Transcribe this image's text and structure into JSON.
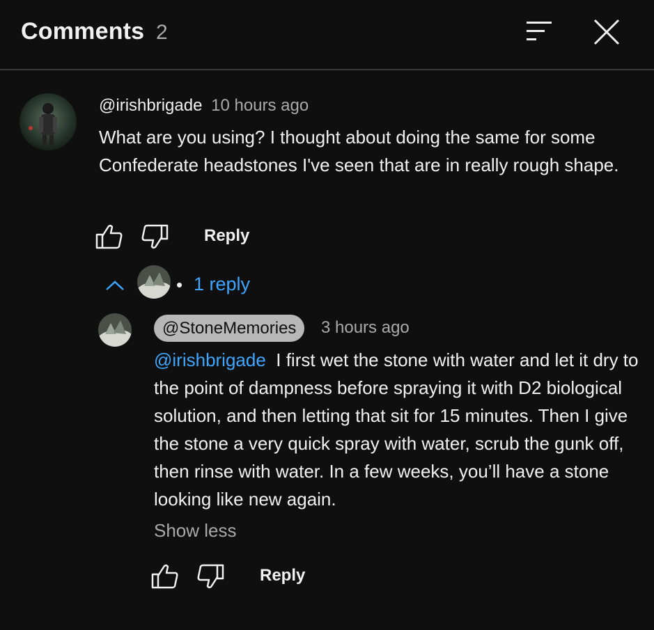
{
  "header": {
    "title": "Comments",
    "count": "2",
    "sort_icon": "sort-icon",
    "close_icon": "close-icon"
  },
  "comments": [
    {
      "author": "@irishbrigade",
      "time": "10 hours ago",
      "text": "What are you using? I thought about doing the same for some Confederate headstones I've seen that are in really rough shape.",
      "reply_label": "Reply",
      "replies_label": "1 reply",
      "replies": [
        {
          "author": "@StoneMemories",
          "time": "3 hours ago",
          "mention": "@irishbrigade",
          "text": "I first wet the stone with water and let it dry to the point of dampness before spraying it with D2 biological solution, and then letting that sit for 15 minutes. Then I give the stone a very quick spray with water, scrub the gunk off, then rinse with water. In a few weeks, you’ll have a stone looking like new again.",
          "show_less_label": "Show less",
          "reply_label": "Reply"
        }
      ]
    }
  ],
  "colors": {
    "background": "#0f0f0f",
    "text": "#f1f1f1",
    "secondary": "#aaaaaa",
    "link": "#3ea6ff",
    "chip": "#b8b8b8"
  }
}
